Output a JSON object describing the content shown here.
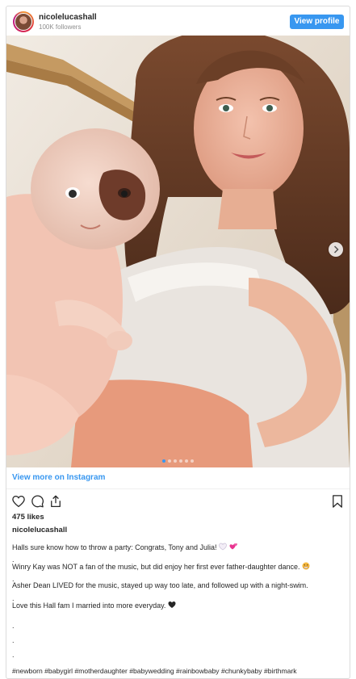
{
  "header": {
    "username": "nicolelucashall",
    "followers": "100K followers",
    "view_profile_label": "View profile"
  },
  "photo": {
    "carousel_dots": 6,
    "active_dot": 0
  },
  "view_more_label": "View more on Instagram",
  "likes": "475 likes",
  "caption": {
    "username": "nicolelucashall",
    "line1": "Halls sure know how to throw a party: Congrats, Tony and Julia!",
    "dot1": ".",
    "line2": "Winry Kay was NOT a fan of the music, but did enjoy her first ever father-daughter dance.",
    "dot2": ".",
    "line3": "Asher Dean LIVED for the music, stayed up way too late, and followed up with a night-swim.",
    "dot3": ".",
    "line4": "Love this Hall fam I married into more everyday.",
    "dot4": ".",
    "dot5": ".",
    "dot6": ".",
    "hashtags": "#newborn #babygirl #motherdaughter #babywedding #rainbowbaby #chunkybaby #birthmark"
  },
  "icons": {
    "like": "heart-outline-icon",
    "comment": "comment-bubble-icon",
    "share": "share-icon",
    "save": "bookmark-icon"
  },
  "colors": {
    "accent": "#3897f0",
    "text": "#262626",
    "muted": "#8e8e8e"
  }
}
